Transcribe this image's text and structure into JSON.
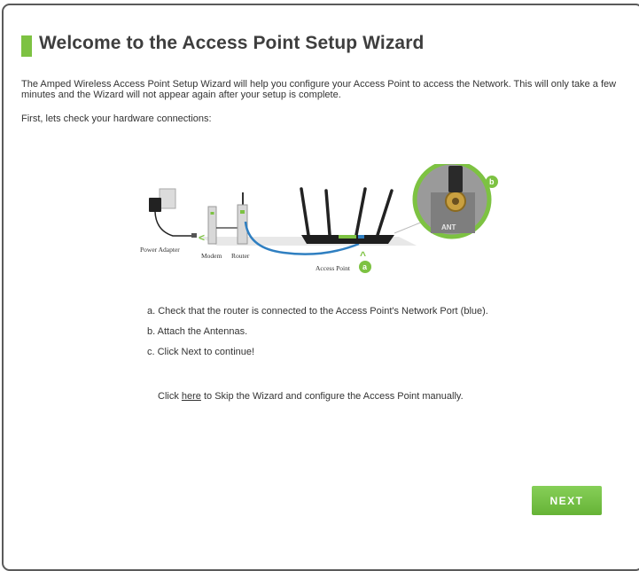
{
  "page": {
    "title": "Welcome to the Access Point Setup Wizard",
    "intro": "The Amped Wireless Access Point Setup Wizard will help you configure your Access Point to access the Network. This will only take a few minutes and the Wizard will not appear again after your setup is complete.",
    "first_check": "First, lets check your hardware connections:"
  },
  "diagram": {
    "power_adapter_label": "Power Adapter",
    "modem_label": "Modem",
    "router_label": "Router",
    "access_point_label": "Access Point",
    "badge_a": "a",
    "badge_b": "b",
    "ant_label": "ANT",
    "arrow_left": "<",
    "arrow_up": "^"
  },
  "steps": [
    "a. Check that the router is connected to the Access Point's Network Port (blue).",
    "b. Attach the Antennas.",
    "c. Click Next to continue!"
  ],
  "skip": {
    "prefix": "Click ",
    "link": "here",
    "suffix": " to Skip the Wizard and configure the Access Point manually."
  },
  "buttons": {
    "next": "NEXT"
  },
  "colors": {
    "accent_green": "#7dc242",
    "cable_blue": "#2f7fc1",
    "text": "#333333"
  }
}
